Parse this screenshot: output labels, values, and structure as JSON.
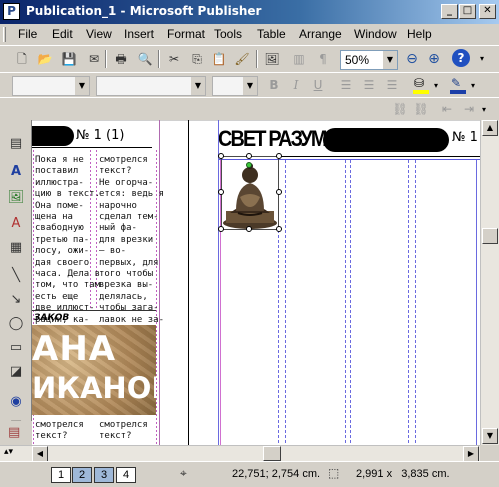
{
  "window": {
    "title": "Publication_1 - Microsoft Publisher",
    "app_icon": "P",
    "minimize": "_",
    "maximize": "□",
    "close": "✕"
  },
  "menu": [
    "File",
    "Edit",
    "View",
    "Insert",
    "Format",
    "Tools",
    "Table",
    "Arrange",
    "Window",
    "Help"
  ],
  "toolbar": {
    "zoom": "50%",
    "help_icon": "?"
  },
  "format_bar": {
    "bold": "B",
    "italic": "I",
    "underline": "U"
  },
  "doc": {
    "issue_left": "№ 1 (1)",
    "masthead": "СВЕТ РАЗУМА",
    "issue_right": "№ 1",
    "col1": "Пока я не\nпоставил\nиллюстра-\nцию в текст.\nОна поме-\nщена на\nсвабодную\nтретью па-\nлосу, ожи-\nдая своего\nчаса. Дела в\nтом, что там\nесть еще\nдве иллюст-\nрации, ка-",
    "col2": "смотрелся\nтекст?\nНе огорча-\nется: ведь я\nнарочно\nсделал тем-\nный фа-\nдля врезки\n— во-\nпервых, для\nтого чтобы\nврезка вы-\nделялась,\nчтобы зага-\nлавок не за-",
    "heading_small": "ЗАКОВ",
    "banner_line1": "АНА",
    "banner_line2": "ИКАНОВ",
    "col1_bottom": "смотрелся\nтекст?",
    "col2_bottom": "смотрелся\nтекст?"
  },
  "status": {
    "pages": [
      "1",
      "2",
      "3",
      "4"
    ],
    "position": "22,751; 2,754 cm.",
    "size": "2,991 x   3,835 cm."
  }
}
